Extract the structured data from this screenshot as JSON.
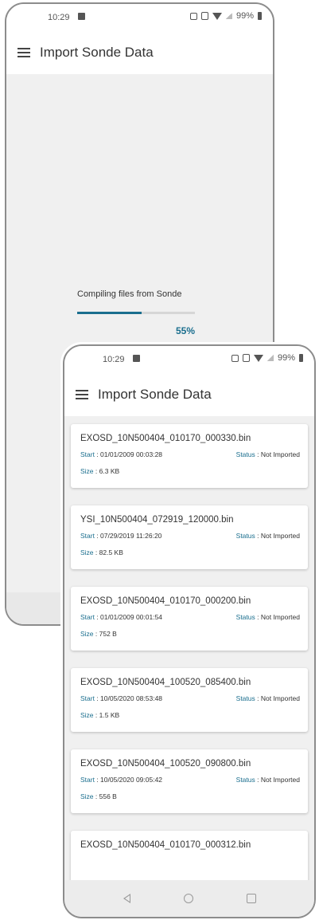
{
  "status": {
    "time": "10:29",
    "battery": "99%"
  },
  "screen1": {
    "title": "Import Sonde Data",
    "progress_label": "Compiling files from Sonde",
    "progress_percent": 55,
    "progress_text": "55%"
  },
  "screen2": {
    "title": "Import Sonde Data",
    "labels": {
      "start": "Start",
      "status": "Status",
      "size": "Size"
    },
    "files": [
      {
        "name": "EXOSD_10N500404_010170_000330.bin",
        "start": "01/01/2009 00:03:28",
        "status": "Not Imported",
        "size": "6.3 KB"
      },
      {
        "name": "YSI_10N500404_072919_120000.bin",
        "start": "07/29/2019 11:26:20",
        "status": "Not Imported",
        "size": "82.5 KB"
      },
      {
        "name": "EXOSD_10N500404_010170_000200.bin",
        "start": "01/01/2009 00:01:54",
        "status": "Not Imported",
        "size": "752 B"
      },
      {
        "name": "EXOSD_10N500404_100520_085400.bin",
        "start": "10/05/2020 08:53:48",
        "status": "Not Imported",
        "size": "1.5 KB"
      },
      {
        "name": "EXOSD_10N500404_100520_090800.bin",
        "start": "10/05/2020 09:05:42",
        "status": "Not Imported",
        "size": "556 B"
      },
      {
        "name": "EXOSD_10N500404_010170_000312.bin",
        "start": "",
        "status": "",
        "size": ""
      }
    ]
  },
  "icons": {
    "menu": "hamburger-icon",
    "back": "nav-back-icon",
    "home": "nav-home-icon",
    "recent": "nav-recent-icon"
  },
  "colors": {
    "accent": "#1a6e8e",
    "background": "#f0f0f0"
  }
}
